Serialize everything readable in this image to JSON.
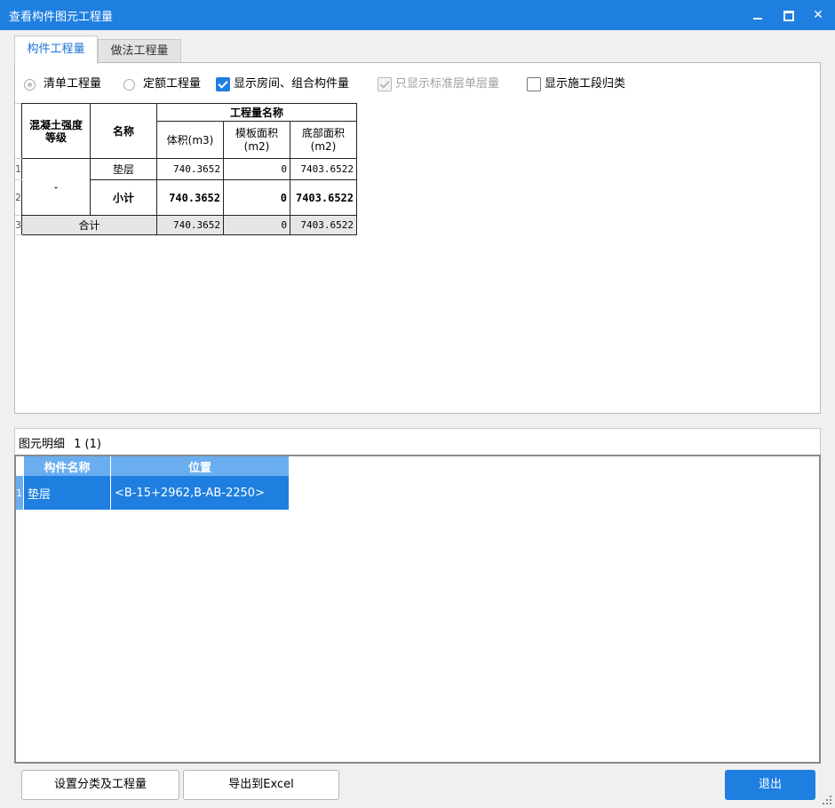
{
  "window": {
    "title": "查看构件图元工程量"
  },
  "tabs": [
    {
      "label": "构件工程量",
      "active": true
    },
    {
      "label": "做法工程量",
      "active": false
    }
  ],
  "options": {
    "radio_list": "清单工程量",
    "radio_quota": "定额工程量",
    "chk_show_room": "显示房间、组合构件量",
    "chk_std_floor": "只显示标准层单层量",
    "chk_stage": "显示施工段归类"
  },
  "summary_table": {
    "col_grade": "混凝土强度等级",
    "col_name": "名称",
    "col_qty_group": "工程量名称",
    "col_volume": "体积(m3)",
    "col_formwork": "模板面积(m2)",
    "col_bottom": "底部面积(m2)",
    "rows": [
      {
        "no": "1",
        "grade": "-",
        "name": "垫层",
        "volume": "740.3652",
        "formwork": "0",
        "bottom": "7403.6522"
      },
      {
        "no": "2",
        "name": "小计",
        "volume": "740.3652",
        "formwork": "0",
        "bottom": "7403.6522"
      },
      {
        "no": "3",
        "name": "合计",
        "volume": "740.3652",
        "formwork": "0",
        "bottom": "7403.6522"
      }
    ]
  },
  "detail": {
    "label": "图元明细",
    "count": "1 (1)",
    "col_name": "构件名称",
    "col_pos": "位置",
    "rows": [
      {
        "no": "1",
        "name": "垫层",
        "pos": "<B-15+2962,B-AB-2250>"
      }
    ]
  },
  "buttons": {
    "classify": "设置分类及工程量",
    "export": "导出到Excel",
    "exit": "退出"
  },
  "colors": {
    "accent": "#1f7fe0",
    "header_light": "#6aaef0"
  }
}
